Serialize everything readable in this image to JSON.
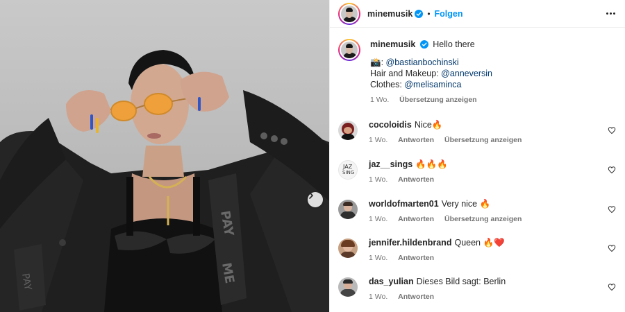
{
  "post": {
    "username": "minemusik",
    "follow_label": "Folgen",
    "dot": "•"
  },
  "caption": {
    "username": "minemusik",
    "text": "Hello there",
    "line1_prefix": "📸: ",
    "line1_mention": "@bastianbochinski",
    "line2_prefix": "Hair and Makeup: ",
    "line2_mention": "@anneversin",
    "line3_prefix": "Clothes: ",
    "line3_mention": "@melisaminca",
    "time": "1 Wo.",
    "translate": "Übersetzung anzeigen"
  },
  "comments": [
    {
      "username": "cocoloidis",
      "text": "Nice🔥",
      "time": "1 Wo.",
      "reply": "Antworten",
      "translate": "Übersetzung anzeigen"
    },
    {
      "username": "jaz__sings",
      "text": "🔥🔥🔥",
      "time": "1 Wo.",
      "reply": "Antworten"
    },
    {
      "username": "worldofmarten01",
      "text": "Very nice 🔥",
      "time": "1 Wo.",
      "reply": "Antworten",
      "translate": "Übersetzung anzeigen"
    },
    {
      "username": "jennifer.hildenbrand",
      "text": "Queen 🔥❤️",
      "time": "1 Wo.",
      "reply": "Antworten"
    },
    {
      "username": "das_yulian",
      "text": "Dieses Bild sagt: Berlin",
      "time": "1 Wo.",
      "reply": "Antworten"
    }
  ],
  "icons": {
    "verified": "verified-badge-icon",
    "more": "more-options-icon",
    "heart": "heart-icon",
    "next": "chevron-right-icon"
  },
  "colors": {
    "link_blue": "#0095f6",
    "mention": "#00376b",
    "muted": "#737373",
    "verified": "#0095f6"
  }
}
